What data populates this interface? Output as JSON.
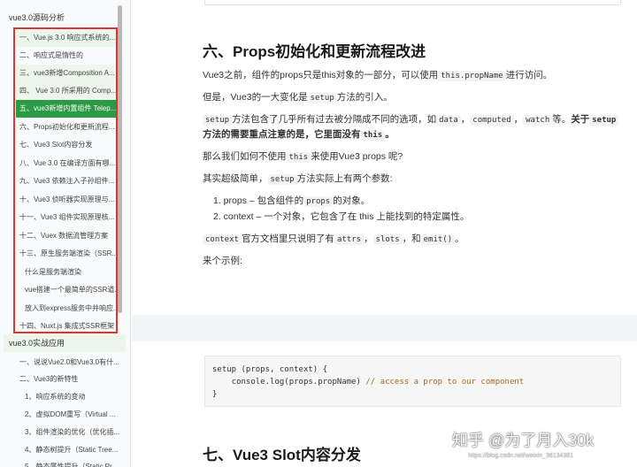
{
  "sidebar": {
    "section1": "vue3.0源码分析",
    "items1": [
      "一、Vue.js 3.0 响应式系统的...",
      "二、响应式是惰性的",
      "三、vue3新增Composition A...",
      "四、 Vue 3.0 所采用的 Comp...",
      "五、vue3新增内置组件 Telep...",
      "六、Props初始化和更新流程...",
      "七、Vue3 Slot内容分发",
      "八、Vue 3.0 在编译方面有哪...",
      "九、Vue3 依赖注入子孙组件...",
      "十、Vue3 侦听器实现原理与...",
      "十一、Vue3 组件实现原理核...",
      "十二、Vuex 数据流管理方案",
      "十三、原生服务端渲染（SSR...",
      "什么是服务端渲染",
      "vue搭建一个最简单的SSR道...",
      "放入到express服务中并响应...",
      "十四、Nuxt.js 集成式SSR框架"
    ],
    "section2": "vue3.0实战应用",
    "items2": [
      "一、说说Vue2.0和Vue3.0有什...",
      "二、Vue3的新特性",
      "1、响应系统的变动",
      "2、虚拟DOM重写（Virtual ...",
      "3、组件渲染的优化（优化插...",
      "4、静态树提升（Static Tree...",
      "5、静态属性提升（Static Pr..."
    ]
  },
  "main": {
    "heading6": "六、Props初始化和更新流程改进",
    "p1_pre": "Vue3之前，组件的props只是this对象的一部分，可以使用",
    "p1_code": "this.propName",
    "p1_post": "进行访问。",
    "p2_pre": "但是，Vue3的一大变化是",
    "p2_code": "setup",
    "p2_post": "方法的引入。",
    "p3_code1": "setup",
    "p3_t1": "方法包含了几乎所有过去被分隔成不同的选项，如",
    "p3_code2": "data",
    "p3_t2": "，",
    "p3_code3": "computed",
    "p3_t3": "，",
    "p3_code4": "watch",
    "p3_t4": "等。",
    "p3_bold1": "关于",
    "p3_bold_code": "setup",
    "p3_line2_bold": "方法的需要重点注意的是，它里面没有",
    "p3_line2_code": "this",
    "p3_line2_end": "。",
    "p4_pre": "那么我们如何不使用",
    "p4_code": "this",
    "p4_post": "来使用Vue3 props 呢?",
    "p5_pre": "其实超级简单，",
    "p5_code": "setup",
    "p5_post": "方法实际上有两个参数:",
    "li1_pre": "1. props – 包含组件的",
    "li1_code": "props",
    "li1_post": "的对象。",
    "li2": "2. context – 一个对象，它包含了在 this 上能找到的特定属性。",
    "p6_code1": "context",
    "p6_t1": "官方文档里只说明了有",
    "p6_code2": "attrs",
    "p6_t2": "，",
    "p6_code3": "slots",
    "p6_t3": "，和",
    "p6_code4": "emit()",
    "p6_t4": "。",
    "p7": "来个示例:",
    "code_line1": "setup (props, context) {",
    "code_line2_pre": "    console.log(props.propName) ",
    "code_line2_comment": "// access a prop to our component",
    "code_line3": "}",
    "heading7": "七、Vue3 Slot内容分发"
  },
  "watermark": {
    "big": "知乎 @为了月入30k",
    "small": "https://blog.csdn.net/weixin_36134381"
  }
}
